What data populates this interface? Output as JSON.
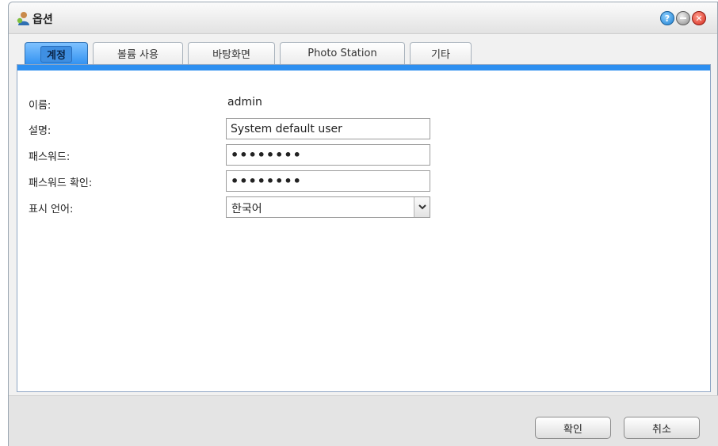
{
  "window": {
    "title": "옵션",
    "icons": {
      "app": "user-icon",
      "help": "help-icon",
      "minimize": "minimize-icon",
      "close": "close-icon"
    }
  },
  "tabs": [
    {
      "label": "계정",
      "active": true
    },
    {
      "label": "볼륨 사용",
      "active": false
    },
    {
      "label": "바탕화면",
      "active": false
    },
    {
      "label": "Photo Station",
      "active": false
    },
    {
      "label": "기타",
      "active": false
    }
  ],
  "form": {
    "name": {
      "label": "이름:",
      "value": "admin"
    },
    "description": {
      "label": "설명:",
      "value": "System default user"
    },
    "password": {
      "label": "패스워드:",
      "value": "••••••••"
    },
    "password_confirm": {
      "label": "패스워드 확인:",
      "value": "••••••••"
    },
    "language": {
      "label": "표시 언어:",
      "value": "한국어"
    }
  },
  "footer": {
    "ok_label": "확인",
    "cancel_label": "취소"
  },
  "colors": {
    "accent": "#2d8ff0",
    "panel_border": "#8ea6c4"
  }
}
